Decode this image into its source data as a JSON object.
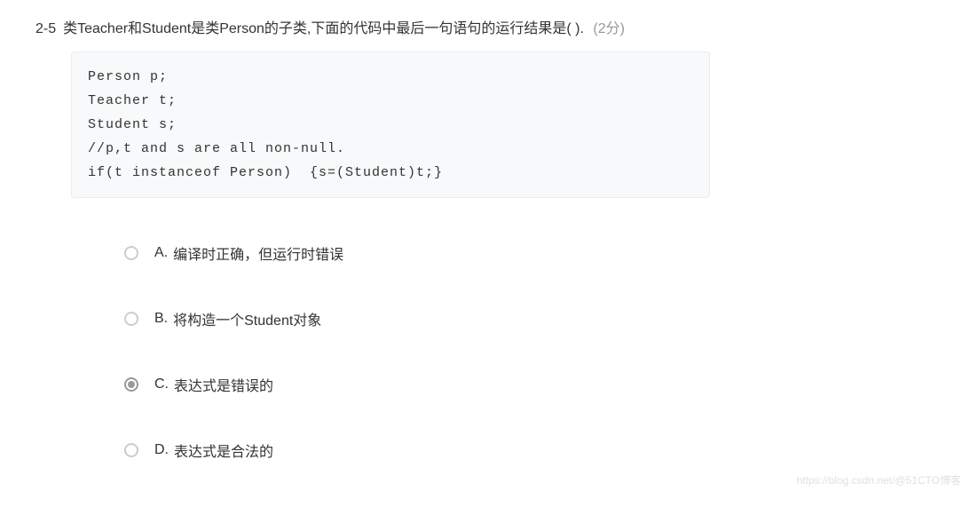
{
  "question": {
    "number": "2-5",
    "text": "类Teacher和Student是类Person的子类,下面的代码中最后一句语句的运行结果是( ).",
    "points": "(2分)"
  },
  "code": "Person p;\nTeacher t;\nStudent s;\n//p,t and s are all non-null.\nif(t instanceof Person)  {s=(Student)t;}",
  "options": [
    {
      "label": "A.",
      "text": "编译时正确，但运行时错误",
      "selected": false
    },
    {
      "label": "B.",
      "text": "将构造一个Student对象",
      "selected": false
    },
    {
      "label": "C.",
      "text": "表达式是错误的",
      "selected": true
    },
    {
      "label": "D.",
      "text": "表达式是合法的",
      "selected": false
    }
  ],
  "watermark": "https://blog.csdn.net/@51CTO博客"
}
